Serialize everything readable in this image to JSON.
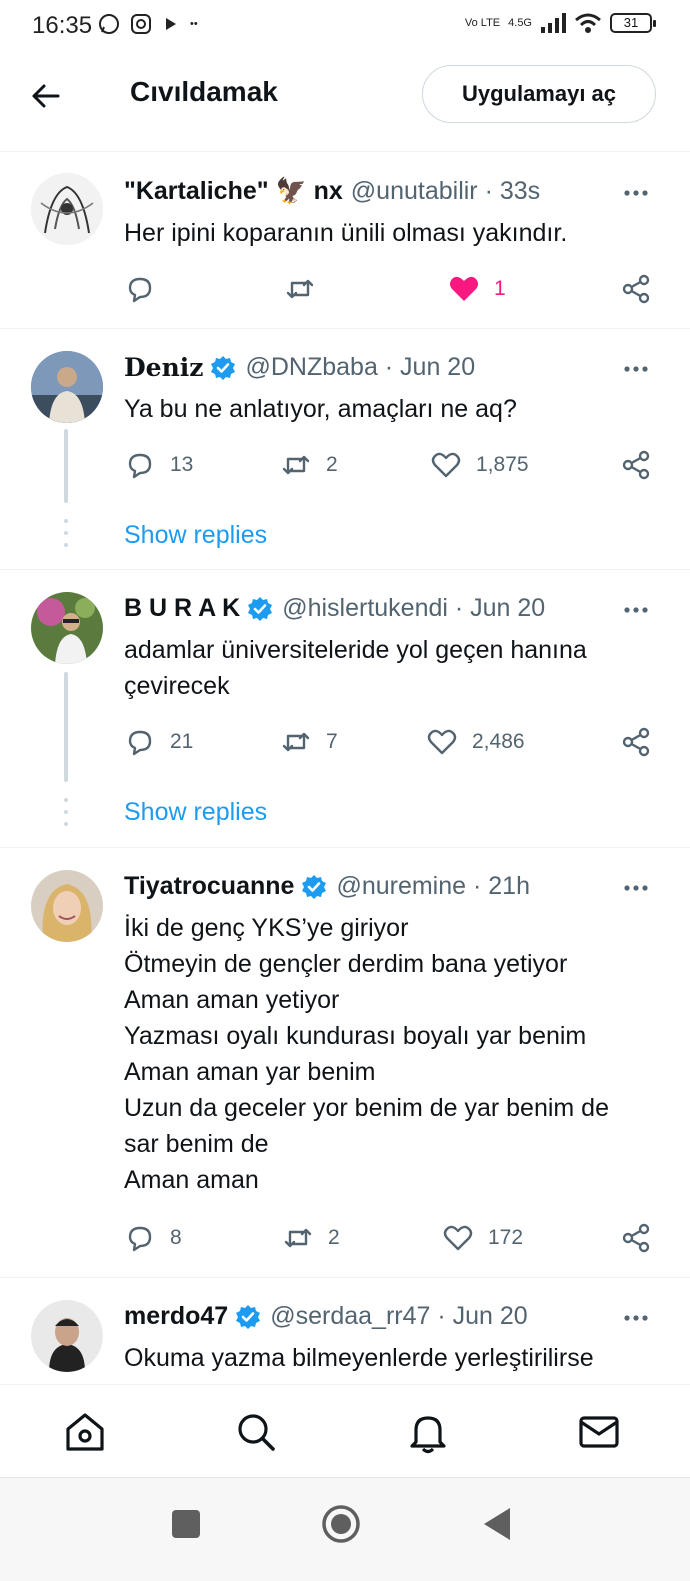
{
  "status_bar": {
    "time": "16:35",
    "network": "4.5G",
    "volte": "Vo LTE",
    "battery": "31"
  },
  "header": {
    "title": "Cıvıldamak",
    "open_app_label": "Uygulamayı aç"
  },
  "tweets": [
    {
      "name": "\"Kartaliche\" 🦅 nx",
      "handle": "@unutabilir · 33s",
      "verified": false,
      "lines": [
        "Her ipini koparanın ünili olması yakındır."
      ],
      "replies": "",
      "retweets": "",
      "likes": "1",
      "liked": true,
      "avatar_icon": "sketch-art-avatar"
    },
    {
      "name": "Deniz",
      "handle": "@DNZbaba · Jun 20",
      "verified": true,
      "lines": [
        "Ya bu ne anlatıyor, amaçları ne aq?"
      ],
      "replies": "13",
      "retweets": "2",
      "likes": "1,875",
      "liked": false,
      "show_replies": "Show replies",
      "avatar_icon": "person-photo-avatar"
    },
    {
      "name": "B U R A K",
      "handle": "@hislertukendi · Jun 20",
      "verified": true,
      "lines": [
        "adamlar üniversiteleride yol geçen hanına",
        "çevirecek"
      ],
      "replies": "21",
      "retweets": "7",
      "likes": "2,486",
      "liked": false,
      "show_replies": "Show replies",
      "avatar_icon": "person-photo-avatar"
    },
    {
      "name": "Tiyatrocuanne",
      "handle": "@nuremine · 21h",
      "verified": true,
      "lines": [
        "İki de genç YKS’ye giriyor",
        "Ötmeyin de gençler derdim bana yetiyor",
        "Aman aman yetiyor",
        "Yazması oyalı kundurası boyalı yar benim",
        "Aman aman yar benim",
        "Uzun da geceler yor benim de yar benim de",
        "sar benim de",
        "Aman aman"
      ],
      "replies": "8",
      "retweets": "2",
      "likes": "172",
      "liked": false,
      "avatar_icon": "person-photo-avatar"
    },
    {
      "name": "merdo47",
      "handle": "@serdaa_rr47 · Jun 20",
      "verified": true,
      "lines": [
        "Okuma yazma bilmeyenlerde yerleştirilirse"
      ],
      "avatar_icon": "person-photo-avatar"
    }
  ],
  "colors": {
    "accent": "#1d9bf0",
    "like": "#f91880",
    "secondary_text": "#536471"
  },
  "bottom_nav": [
    "home-icon",
    "search-icon",
    "bell-icon",
    "mail-icon"
  ],
  "system_nav": [
    "recents-square",
    "home-circle",
    "back-triangle"
  ]
}
